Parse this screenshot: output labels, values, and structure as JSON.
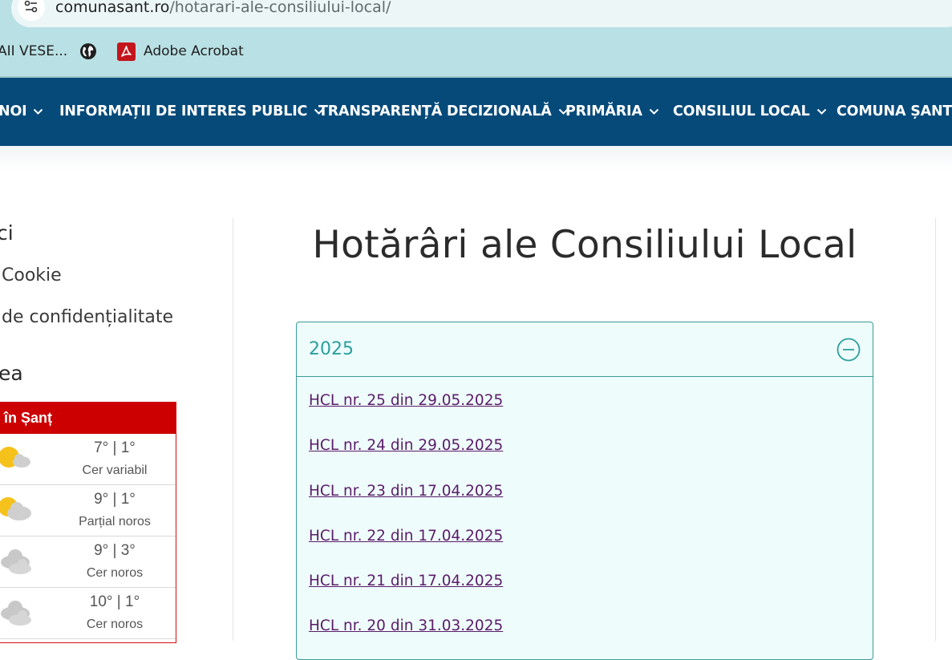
{
  "browser": {
    "url_domain": "comunasant.ro",
    "url_path": "/hotarari-ale-consiliului-local/",
    "bookmarks": [
      {
        "label": "AII VESE..."
      },
      {
        "label": ""
      },
      {
        "label": "Adobe Acrobat"
      }
    ]
  },
  "nav": {
    "items": [
      {
        "label": "NOI"
      },
      {
        "label": "INFORMAȚII DE INTERES PUBLIC"
      },
      {
        "label": "TRANSPARENȚĂ DECIZIONALĂ"
      },
      {
        "label": "PRIMĂRIA"
      },
      {
        "label": "CONSILIUL LOCAL"
      },
      {
        "label": "COMUNA ȘANT"
      }
    ]
  },
  "sidebar": {
    "heading1": "ci",
    "links": [
      "Cookie",
      "de confidențialitate"
    ],
    "heading2": "ea",
    "weather": {
      "title": "în Șanț",
      "days": [
        {
          "temp": "7° | 1°",
          "desc": "Cer variabil",
          "icon": "sun-cloud-icon"
        },
        {
          "temp": "9° | 1°",
          "desc": "Parțial noros",
          "icon": "sun-cloud-icon"
        },
        {
          "temp": "9° | 3°",
          "desc": "Cer noros",
          "icon": "cloud-icon"
        },
        {
          "temp": "10° | 1°",
          "desc": "Cer noros",
          "icon": "cloud-icon"
        }
      ]
    }
  },
  "main": {
    "title": "Hotărâri ale Consiliului Local",
    "accordion": {
      "year": "2025",
      "expanded": true,
      "links": [
        "HCL nr. 25 din 29.05.2025",
        "HCL nr. 24 din 29.05.2025",
        "HCL nr. 23 din 17.04.2025",
        "HCL nr. 22 din 17.04.2025",
        "HCL nr. 21 din 17.04.2025",
        "HCL nr. 20 din 31.03.2025"
      ]
    }
  },
  "colors": {
    "nav_bg": "#064a7a",
    "browser_bar": "#b9e0e4",
    "accordion_border": "#3d9a9a",
    "accordion_bg": "#eefcfc",
    "link_visited": "#5a1c68",
    "weather_red": "#cc0000"
  }
}
